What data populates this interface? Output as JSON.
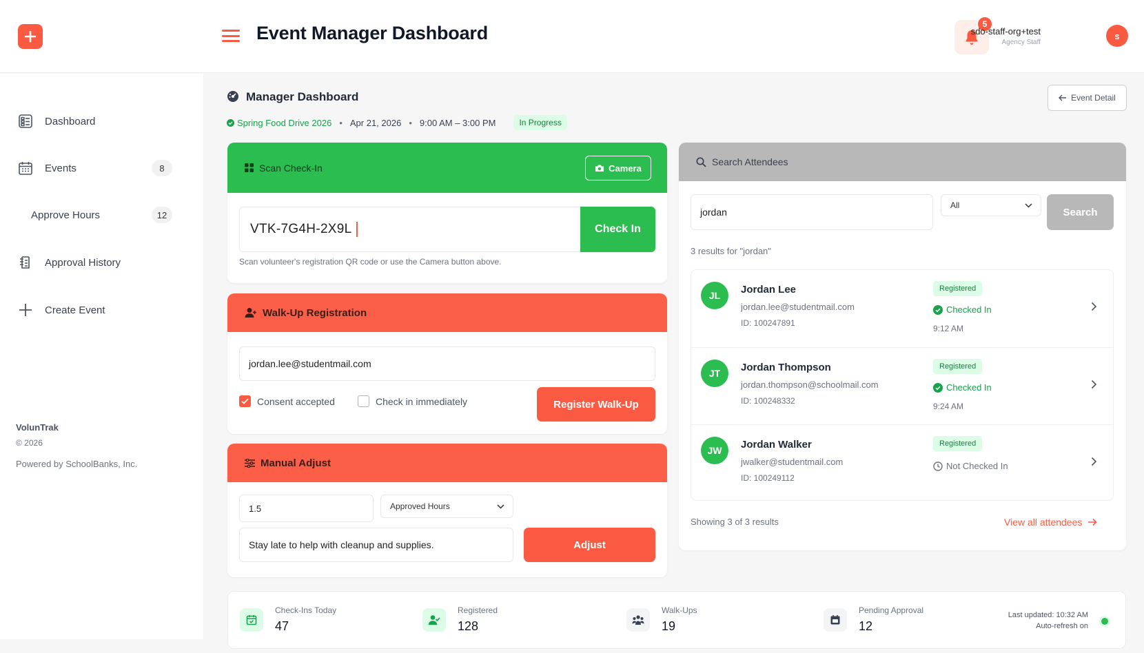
{
  "header": {
    "title": "Event Manager Dashboard",
    "notification_count": "5",
    "user_name": "sdo-staff-org+test",
    "user_role": "Agency Staff",
    "avatar_initial": "s"
  },
  "sidebar": {
    "items": [
      {
        "label": "Dashboard",
        "icon": "dashboard-icon"
      },
      {
        "label": "Events",
        "icon": "calendar-icon",
        "count": "8"
      },
      {
        "label": "Approve Hours",
        "count": "12"
      },
      {
        "label": "Approval History",
        "icon": "history-icon"
      },
      {
        "label": "Create Event",
        "icon": "plus-icon"
      }
    ],
    "brand": "VolunTrak",
    "copyright": "© 2026",
    "powered_by": "Powered by SchoolBanks, Inc."
  },
  "content": {
    "title": "Manager Dashboard",
    "event_name": "Spring Food Drive 2026",
    "event_date": "Apr 21, 2026",
    "event_time": "9:00 AM – 3:00 PM",
    "event_status": "In Progress",
    "event_detail_label": "Event Detail"
  },
  "scan": {
    "title": "Scan Check-In",
    "camera_label": "Camera",
    "code_value": "VTK-7G4H-2X9L",
    "checkin_label": "Check In",
    "hint": "Scan volunteer's registration QR code or use the Camera button above."
  },
  "walkup": {
    "title": "Walk-Up Registration",
    "email_value": "jordan.lee@studentmail.com",
    "consent_label": "Consent accepted",
    "consent_checked": true,
    "checkin_label": "Check in immediately",
    "checkin_checked": false,
    "register_label": "Register Walk-Up"
  },
  "manual": {
    "title": "Manual Adjust",
    "hours_value": "1.5",
    "type_selected": "Approved Hours",
    "note_value": "Stay late to help with cleanup and supplies.",
    "adjust_label": "Adjust"
  },
  "search": {
    "title": "Search Attendees",
    "query": "jordan",
    "filter_selected": "All",
    "button_label": "Search",
    "result_count_text": "3 results for \"jordan\"",
    "results": [
      {
        "initials": "JL",
        "name": "Jordan Lee",
        "email": "jordan.lee@studentmail.com",
        "id": "ID: 100247891",
        "registration": "Registered",
        "status": "Checked In",
        "checked_in": true,
        "time": "9:12 AM"
      },
      {
        "initials": "JT",
        "name": "Jordan Thompson",
        "email": "jordan.thompson@schoolmail.com",
        "id": "ID: 100248332",
        "registration": "Registered",
        "status": "Checked In",
        "checked_in": true,
        "time": "9:24 AM"
      },
      {
        "initials": "JW",
        "name": "Jordan Walker",
        "email": "jwalker@studentmail.com",
        "id": "ID: 100249112",
        "registration": "Registered",
        "status": "Not Checked In",
        "checked_in": false,
        "time": ""
      }
    ],
    "showing_text": "Showing 3 of 3 results",
    "view_all_label": "View all attendees"
  },
  "stats": {
    "items": [
      {
        "label": "Check-Ins Today",
        "value": "47",
        "icon": "calendar-check-icon"
      },
      {
        "label": "Registered",
        "value": "128",
        "icon": "user-check-icon"
      },
      {
        "label": "Walk-Ups",
        "value": "19",
        "icon": "group-icon"
      },
      {
        "label": "Pending Approval",
        "value": "12",
        "icon": "calendar-pending-icon"
      }
    ],
    "last_updated": "Last updated: 10:32 AM",
    "auto_refresh": "Auto-refresh on"
  },
  "colors": {
    "accent": "#fb5a42",
    "success": "#2bbd4f",
    "neutral_header": "#b8b8b8"
  }
}
